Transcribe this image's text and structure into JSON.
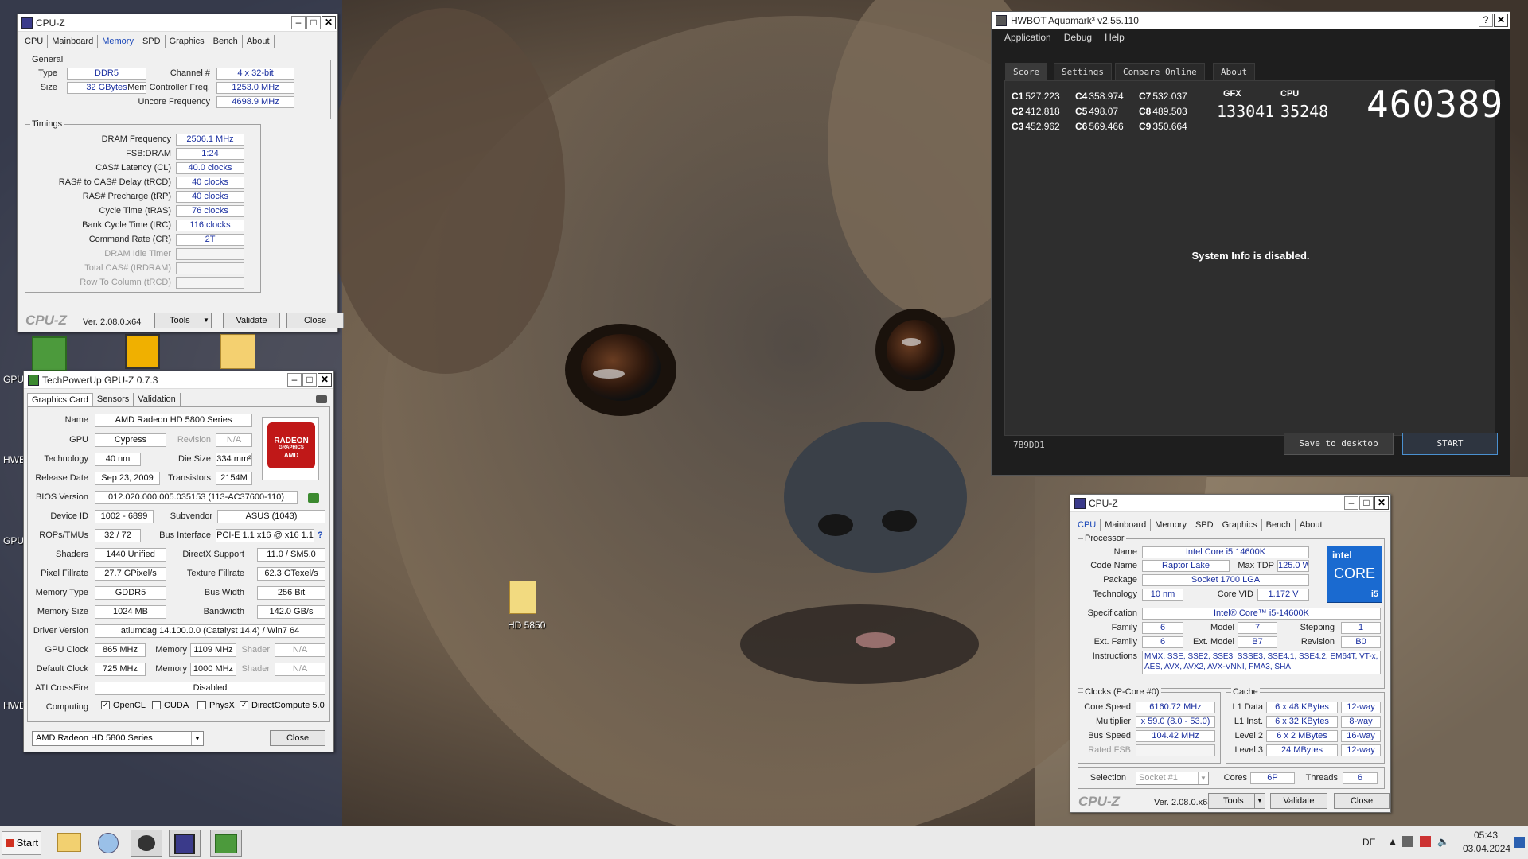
{
  "desktop": {
    "labels": {
      "gpu": "GPU",
      "hwb1": "HWB",
      "gpu2": "GPU",
      "hwb2": "HWB"
    },
    "folder_label": "HD 5850"
  },
  "cpuz_mem": {
    "title": "CPU-Z",
    "tabs": [
      "CPU",
      "Mainboard",
      "Memory",
      "SPD",
      "Graphics",
      "Bench",
      "About"
    ],
    "active_tab": "Memory",
    "general": {
      "title": "General",
      "type_label": "Type",
      "type": "DDR5",
      "size_label": "Size",
      "size": "32 GBytes",
      "channel_label": "Channel #",
      "channel": "4 x 32-bit",
      "mcf_label": "Mem Controller Freq.",
      "mcf": "1253.0 MHz",
      "uncore_label": "Uncore Frequency",
      "uncore": "4698.9 MHz"
    },
    "timings": {
      "title": "Timings",
      "rows": [
        {
          "label": "DRAM Frequency",
          "value": "2506.1 MHz"
        },
        {
          "label": "FSB:DRAM",
          "value": "1:24"
        },
        {
          "label": "CAS# Latency (CL)",
          "value": "40.0 clocks"
        },
        {
          "label": "RAS# to CAS# Delay (tRCD)",
          "value": "40 clocks"
        },
        {
          "label": "RAS# Precharge (tRP)",
          "value": "40 clocks"
        },
        {
          "label": "Cycle Time (tRAS)",
          "value": "76 clocks"
        },
        {
          "label": "Bank Cycle Time (tRC)",
          "value": "116 clocks"
        },
        {
          "label": "Command Rate (CR)",
          "value": "2T"
        },
        {
          "label": "DRAM Idle Timer",
          "value": ""
        },
        {
          "label": "Total CAS# (tRDRAM)",
          "value": ""
        },
        {
          "label": "Row To Column (tRCD)",
          "value": ""
        }
      ]
    },
    "footer": {
      "logo": "CPU-Z",
      "version": "Ver. 2.08.0.x64",
      "tools": "Tools",
      "validate": "Validate",
      "close": "Close"
    }
  },
  "aquamark": {
    "title": "HWBOT Aquamark³ v2.55.110",
    "help": "?",
    "menu": [
      "Application",
      "Debug",
      "Help"
    ],
    "tabs": [
      "Score",
      "Settings",
      "Compare Online",
      "About"
    ],
    "active_tab": "Score",
    "scores": [
      {
        "key": "C1",
        "value": "527.223"
      },
      {
        "key": "C2",
        "value": "412.818"
      },
      {
        "key": "C3",
        "value": "452.962"
      },
      {
        "key": "C4",
        "value": "358.974"
      },
      {
        "key": "C5",
        "value": "498.07"
      },
      {
        "key": "C6",
        "value": "569.466"
      },
      {
        "key": "C7",
        "value": "532.037"
      },
      {
        "key": "C8",
        "value": "489.503"
      },
      {
        "key": "C9",
        "value": "350.664"
      }
    ],
    "gfx_label": "GFX",
    "gfx": "133041",
    "cpu_label": "CPU",
    "cpu": "35248",
    "total": "460389",
    "message": "System Info is disabled.",
    "code": "7B9DD1",
    "save_btn": "Save to desktop",
    "start_btn": "START"
  },
  "gpuz": {
    "title": "TechPowerUp GPU-Z 0.7.3",
    "tabs": [
      "Graphics Card",
      "Sensors",
      "Validation"
    ],
    "active_tab": "Graphics Card",
    "fields": {
      "name_l": "Name",
      "name": "AMD Radeon HD 5800 Series",
      "gpu_l": "GPU",
      "gpu": "Cypress",
      "rev_l": "Revision",
      "rev": "N/A",
      "tech_l": "Technology",
      "tech": "40 nm",
      "die_l": "Die Size",
      "die": "334 mm²",
      "rel_l": "Release Date",
      "rel": "Sep 23, 2009",
      "trans_l": "Transistors",
      "trans": "2154M",
      "bios_l": "BIOS Version",
      "bios": "012.020.000.005.035153 (113-AC37600-110)",
      "dev_l": "Device ID",
      "dev": "1002 - 6899",
      "subv_l": "Subvendor",
      "subv": "ASUS (1043)",
      "rops_l": "ROPs/TMUs",
      "rops": "32 / 72",
      "bus_l": "Bus Interface",
      "bus": "PCI-E 1.1 x16 @ x16 1.1",
      "bus_help": "?",
      "shaders_l": "Shaders",
      "shaders": "1440 Unified",
      "dx_l": "DirectX Support",
      "dx": "11.0 / SM5.0",
      "pix_l": "Pixel Fillrate",
      "pix": "27.7 GPixel/s",
      "tex_l": "Texture Fillrate",
      "tex": "62.3 GTexel/s",
      "memt_l": "Memory Type",
      "memt": "GDDR5",
      "bw_l": "Bus Width",
      "bw": "256 Bit",
      "mems_l": "Memory Size",
      "mems": "1024 MB",
      "band_l": "Bandwidth",
      "band": "142.0 GB/s",
      "drv_l": "Driver Version",
      "drv": "atiumdag 14.100.0.0 (Catalyst 14.4) / Win7 64",
      "gclk_l": "GPU Clock",
      "gclk": "865 MHz",
      "gmem_l": "Memory",
      "gmem": "1109 MHz",
      "gsh_l": "Shader",
      "gsh": "N/A",
      "dclk_l": "Default Clock",
      "dclk": "725 MHz",
      "dmem_l": "Memory",
      "dmem": "1000 MHz",
      "dsh_l": "Shader",
      "dsh": "N/A",
      "cf_l": "ATI CrossFire",
      "cf": "Disabled",
      "comp_l": "Computing",
      "opencl": "OpenCL",
      "cuda": "CUDA",
      "physx": "PhysX",
      "dc": "DirectCompute 5.0"
    },
    "badge": {
      "line1": "RADEON",
      "line2": "GRAPHICS",
      "line3": "AMD"
    },
    "selector": "AMD Radeon HD 5800 Series",
    "close": "Close"
  },
  "cpuz_cpu": {
    "title": "CPU-Z",
    "tabs": [
      "CPU",
      "Mainboard",
      "Memory",
      "SPD",
      "Graphics",
      "Bench",
      "About"
    ],
    "active_tab": "CPU",
    "processor": {
      "title": "Processor",
      "name_l": "Name",
      "name": "Intel Core i5 14600K",
      "code_l": "Code Name",
      "code": "Raptor Lake",
      "tdp_l": "Max TDP",
      "tdp": "125.0 W",
      "pkg_l": "Package",
      "pkg": "Socket 1700 LGA",
      "tech_l": "Technology",
      "tech": "10 nm",
      "vid_l": "Core VID",
      "vid": "1.172 V",
      "spec_l": "Specification",
      "spec": "Intel® Core™ i5-14600K",
      "fam_l": "Family",
      "fam": "6",
      "model_l": "Model",
      "model": "7",
      "step_l": "Stepping",
      "step": "1",
      "efam_l": "Ext. Family",
      "efam": "6",
      "emodel_l": "Ext. Model",
      "emodel": "B7",
      "rev_l": "Revision",
      "rev": "B0",
      "inst_l": "Instructions",
      "inst": "MMX, SSE, SSE2, SSE3, SSSE3, SSE4.1, SSE4.2, EM64T, VT-x, AES, AVX, AVX2, AVX-VNNI, FMA3, SHA"
    },
    "badge": {
      "brand": "intel",
      "core": "CORE",
      "tier": "i5"
    },
    "clocks": {
      "title": "Clocks (P-Core #0)",
      "speed_l": "Core Speed",
      "speed": "6160.72 MHz",
      "mult_l": "Multiplier",
      "mult": "x 59.0 (8.0 - 53.0)",
      "bus_l": "Bus Speed",
      "bus": "104.42 MHz",
      "fsb_l": "Rated FSB",
      "fsb": ""
    },
    "cache": {
      "title": "Cache",
      "rows": [
        {
          "label": "L1 Data",
          "size": "6 x 48 KBytes",
          "way": "12-way"
        },
        {
          "label": "L1 Inst.",
          "size": "6 x 32 KBytes",
          "way": "8-way"
        },
        {
          "label": "Level 2",
          "size": "6 x 2 MBytes",
          "way": "16-way"
        },
        {
          "label": "Level 3",
          "size": "24 MBytes",
          "way": "12-way"
        }
      ]
    },
    "selection_l": "Selection",
    "selection": "Socket #1",
    "cores_l": "Cores",
    "cores": "6P",
    "threads_l": "Threads",
    "threads": "6",
    "footer": {
      "logo": "CPU-Z",
      "version": "Ver. 2.08.0.x64",
      "tools": "Tools",
      "validate": "Validate",
      "close": "Close"
    }
  },
  "taskbar": {
    "start": "Start",
    "lang": "DE",
    "time": "05:43",
    "date": "03.04.2024"
  }
}
